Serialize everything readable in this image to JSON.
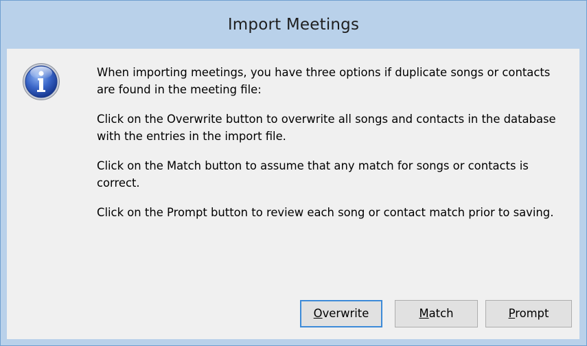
{
  "window": {
    "title": "Import Meetings"
  },
  "dialog": {
    "icon": "information-icon",
    "paragraphs": [
      "When importing meetings, you have three options if duplicate songs or contacts are found in the meeting file:",
      "Click on the Overwrite button to overwrite all songs and contacts in the database with the entries in the import file.",
      "Click on the Match button to assume that any match for songs or contacts is correct.",
      "Click on the Prompt button to review each song or contact match prior to saving."
    ]
  },
  "buttons": {
    "overwrite": {
      "mnemonic": "O",
      "rest": "verwrite",
      "is_default": true
    },
    "match": {
      "mnemonic": "M",
      "rest": "atch"
    },
    "prompt": {
      "mnemonic": "P",
      "rest": "rompt"
    }
  },
  "colors": {
    "titlebar": "#b9d1ea",
    "client": "#f0f0f0",
    "button_face": "#e1e1e1",
    "default_button_border": "#3c8ad8",
    "icon_blue": "#2a56b8"
  }
}
